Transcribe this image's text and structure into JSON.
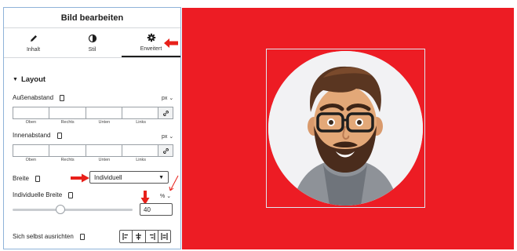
{
  "panel": {
    "title": "Bild bearbeiten",
    "tabs": [
      {
        "label": "Inhalt",
        "icon": "pencil-icon"
      },
      {
        "label": "Stil",
        "icon": "contrast-icon"
      },
      {
        "label": "Erweitert",
        "icon": "gear-icon",
        "active": true
      }
    ]
  },
  "layout": {
    "section_title": "Layout",
    "margin": {
      "label": "Außenabstand",
      "unit": "px",
      "fields": [
        "Oben",
        "Rechts",
        "Unten",
        "Links"
      ]
    },
    "padding": {
      "label": "Innenabstand",
      "unit": "px",
      "fields": [
        "Oben",
        "Rechts",
        "Unten",
        "Links"
      ]
    },
    "width": {
      "label": "Breite",
      "value": "Individuell"
    },
    "custom_width": {
      "label": "Individuelle Breite",
      "unit": "%",
      "value": "40",
      "slider_fraction": 0.4
    },
    "align_self": {
      "label": "Sich selbst ausrichten",
      "options": [
        "align-start-icon",
        "align-center-icon",
        "align-end-icon",
        "align-stretch-icon"
      ]
    }
  },
  "colors": {
    "canvas_bg": "#ed1c24",
    "annotation_arrow": "#e8201a",
    "panel_border": "#8fb3d9"
  }
}
